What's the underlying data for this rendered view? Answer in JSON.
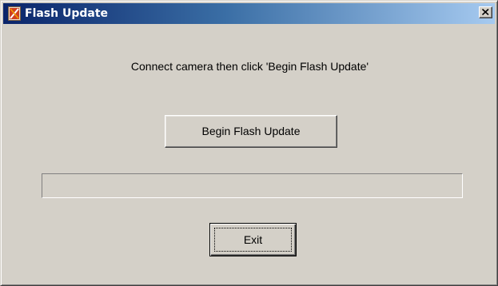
{
  "window": {
    "title": "Flash Update",
    "app_icon": "flash-app-icon",
    "close_icon": "close-icon",
    "titlebar_colors": [
      "#0a246a",
      "#a6caf0"
    ],
    "face_color": "#d4d0c8"
  },
  "main": {
    "prompt": "Connect camera then click  'Begin Flash Update'",
    "begin_button_label": "Begin Flash Update",
    "progress": 0,
    "exit_button_label": "Exit"
  }
}
